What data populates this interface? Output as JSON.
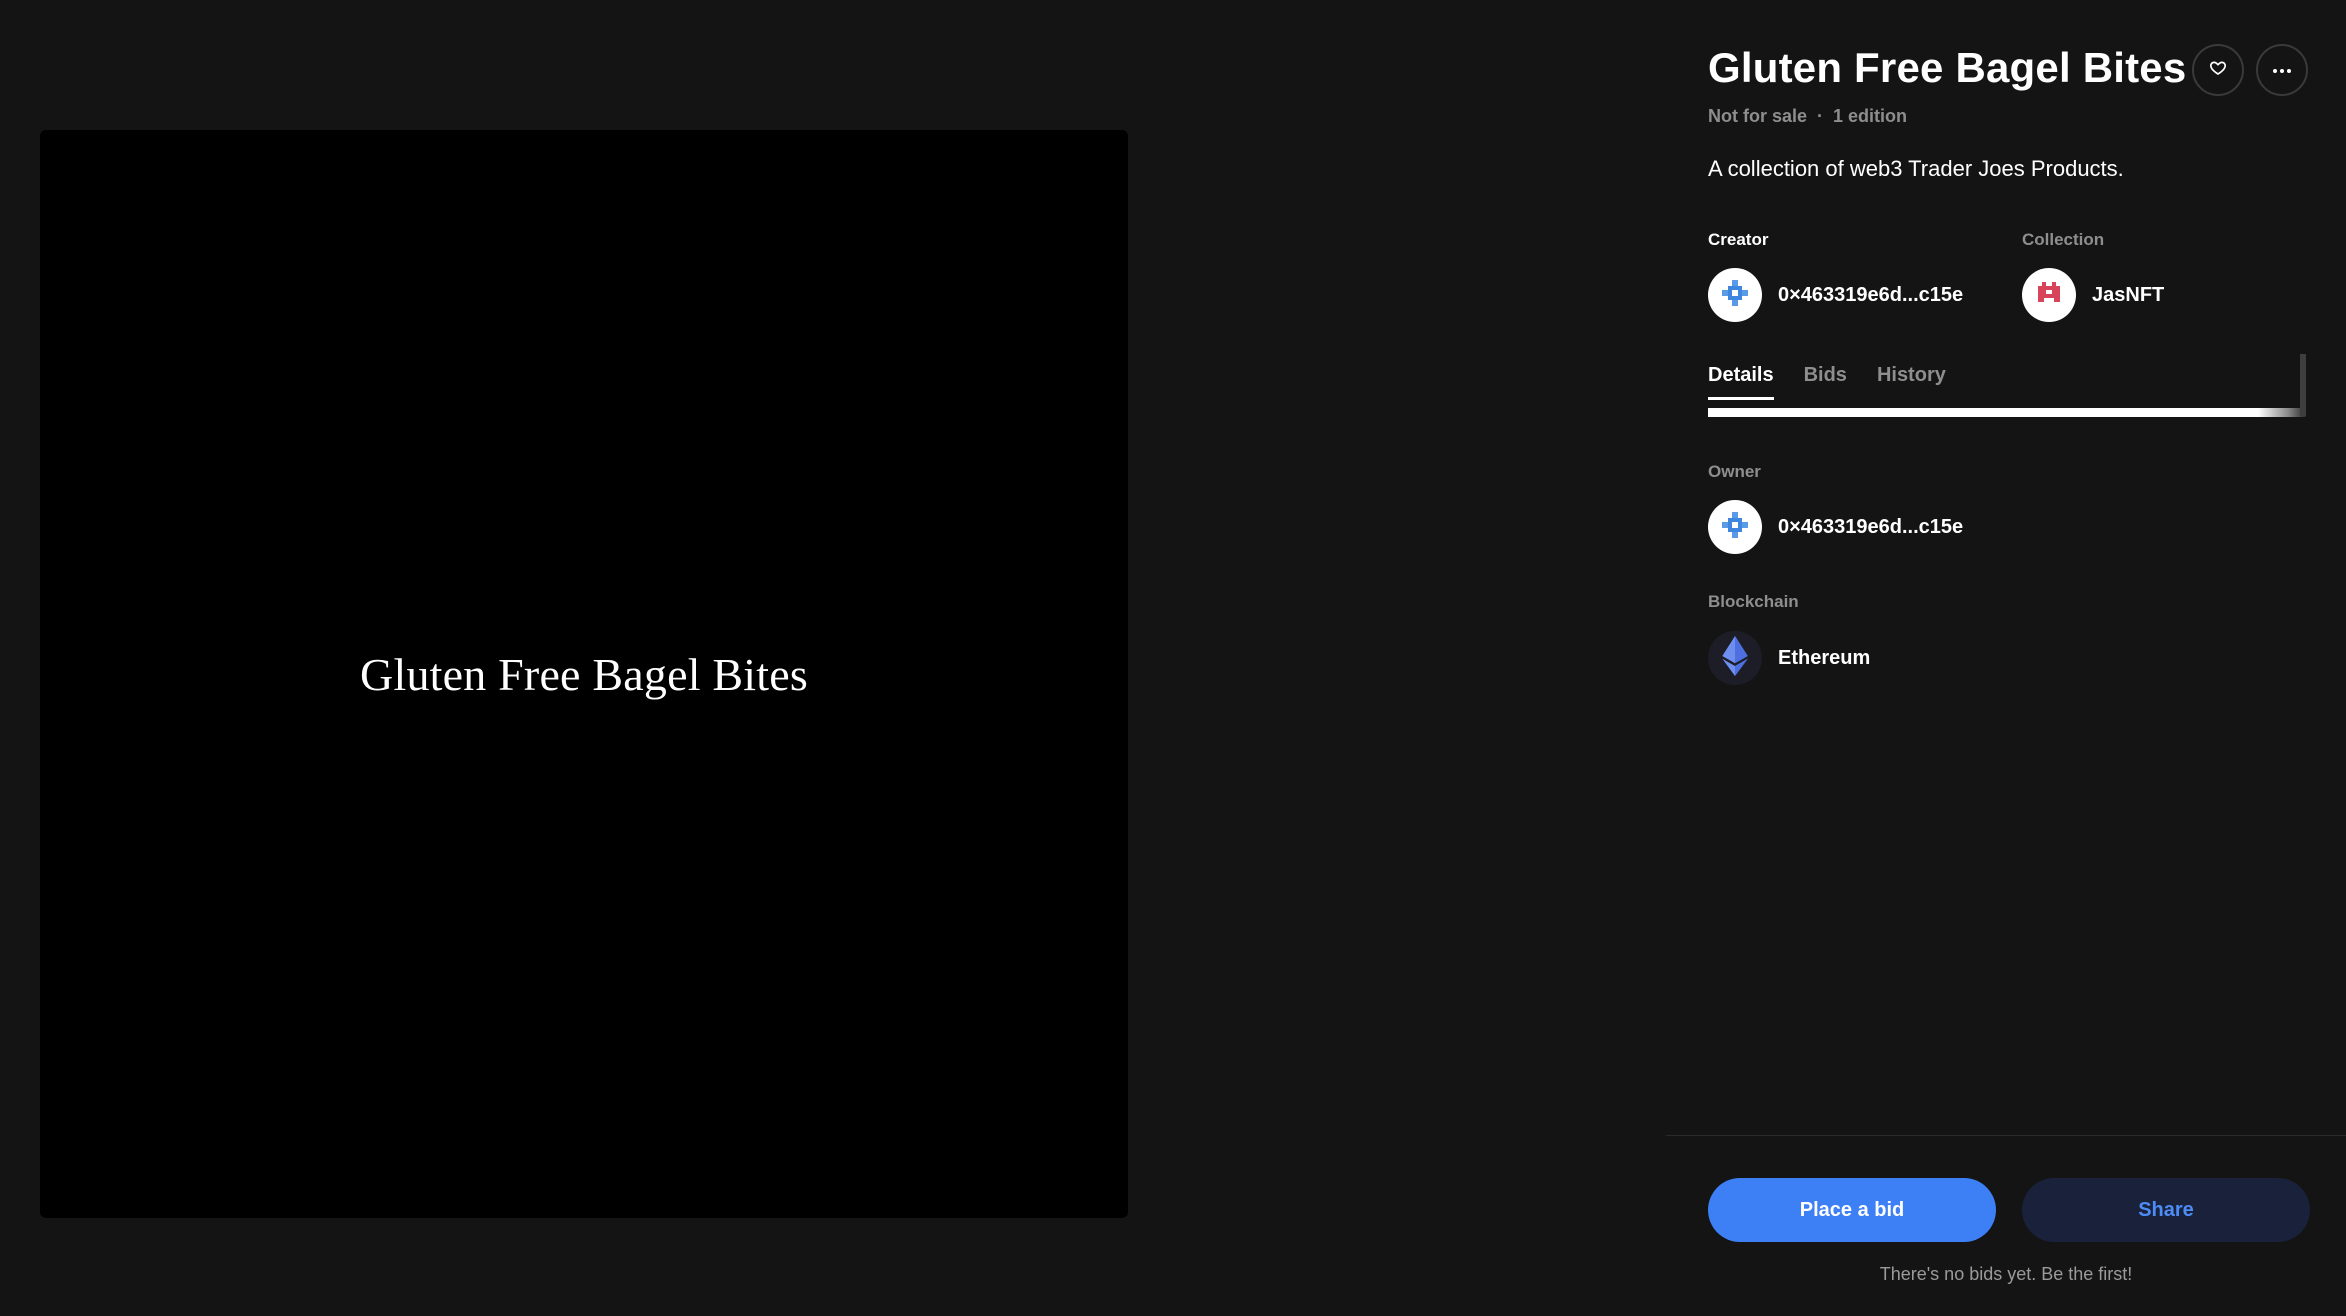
{
  "artwork": {
    "text": "Gluten Free Bagel Bites"
  },
  "header": {
    "title": "Gluten Free Bagel Bites",
    "heart_icon": "heart-outline",
    "more_icon": "ellipsis-horizontal",
    "status": "Not for sale",
    "separator": "·",
    "edition": "1 edition"
  },
  "description": "A collection of web3 Trader Joes Products.",
  "creator": {
    "label": "Creator",
    "address": "0×463319e6d...c15e",
    "avatar_icon": "pixel-avatar-blue"
  },
  "collection": {
    "label": "Collection",
    "name": "JasNFT",
    "avatar_icon": "pixel-avatar-red"
  },
  "tabs": [
    {
      "label": "Details",
      "active": true
    },
    {
      "label": "Bids",
      "active": false
    },
    {
      "label": "History",
      "active": false
    }
  ],
  "details": {
    "owner_label": "Owner",
    "owner_address": "0×463319e6d...c15e",
    "blockchain_label": "Blockchain",
    "blockchain_name": "Ethereum",
    "blockchain_icon": "ethereum-icon"
  },
  "footer": {
    "bid_label": "Place a bid",
    "share_label": "Share",
    "no_bids_text": "There's no bids yet. Be the first!"
  },
  "colors": {
    "background": "#141414",
    "primary": "#3d7ff5",
    "share_bg": "#19223a",
    "muted_text": "#8e8e8e"
  }
}
